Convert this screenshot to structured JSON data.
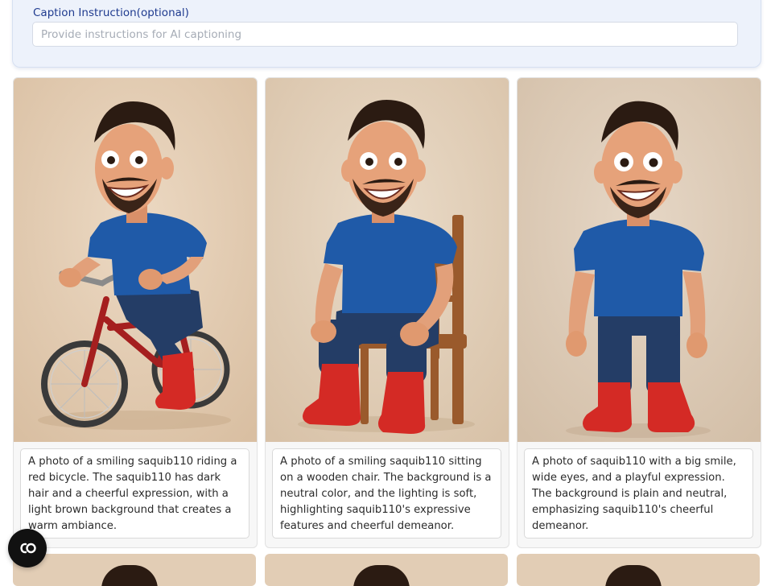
{
  "caption_instruction": {
    "label": "Caption Instruction(optional)",
    "placeholder": "Provide instructions for AI captioning",
    "value": ""
  },
  "cards": [
    {
      "scene": "riding a red bicycle",
      "caption": "A photo of a smiling saquib110 riding a red bicycle. The saquib110 has dark hair and a cheerful expression, with a light brown background that creates a warm ambiance."
    },
    {
      "scene": "sitting on a wooden chair",
      "caption": "A photo of a smiling saquib110 sitting on a wooden chair. The background is a neutral color, and the lighting is soft, highlighting saquib110's expressive features and cheerful demeanor."
    },
    {
      "scene": "standing",
      "caption": "A photo of saquib110 with a big smile, wide eyes, and a playful expression. The background is plain and neutral, emphasizing saquib110's cheerful demeanor."
    }
  ],
  "fab": {
    "icon": "cc-icon",
    "label": "CO"
  },
  "colors": {
    "panel_background": "#edf2fb",
    "label_text": "#1f3b8f",
    "image_background": "#e8d5c0",
    "shirt": "#1f5aa8",
    "jeans": "#243d66",
    "boots": "#d42a25",
    "bicycle": "#a51f1f",
    "chair": "#9a5a2c"
  }
}
